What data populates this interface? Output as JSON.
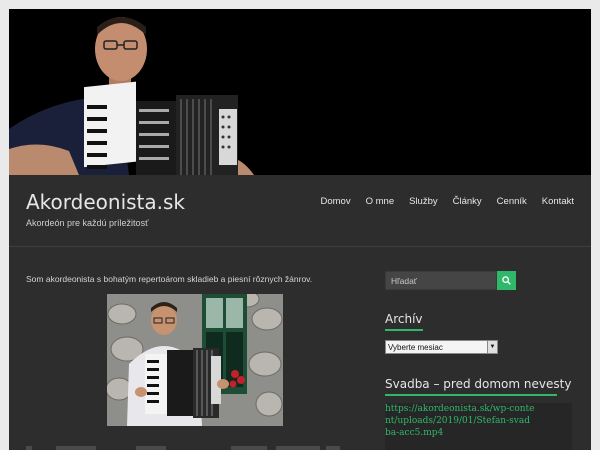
{
  "site": {
    "title": "Akordeonista.sk",
    "tagline": "Akordeón pre každú príležitosť"
  },
  "nav": {
    "items": [
      {
        "label": "Domov"
      },
      {
        "label": "O mne"
      },
      {
        "label": "Služby"
      },
      {
        "label": "Články"
      },
      {
        "label": "Cenník"
      },
      {
        "label": "Kontakt"
      }
    ]
  },
  "content": {
    "intro": "Som akordeonista s bohatým repertoárom skladieb a piesní rôznych žánrov."
  },
  "sidebar": {
    "search_placeholder": "Hľadať",
    "archive_title": "Archív",
    "archive_select": "Vyberte mesiac",
    "video_title": "Svadba – pred domom nevesty",
    "video_url": "https://akordeonista.sk/wp-content/uploads/2019/01/Stefan-svadba-acc5.mp4"
  },
  "colors": {
    "accent": "#30b86a",
    "background": "#2d2d2d",
    "text": "#e6e6e6"
  }
}
